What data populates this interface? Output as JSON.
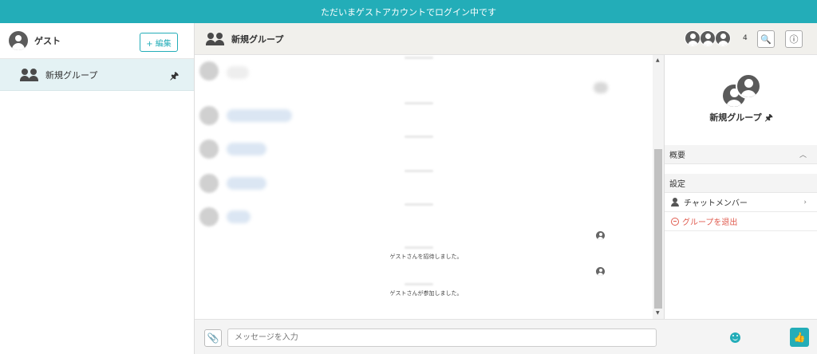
{
  "banner": {
    "text": "ただいまゲストアカウントでログイン中です"
  },
  "sidebar": {
    "user_name": "ゲスト",
    "edit_label": "+ 編集",
    "groups": [
      {
        "label": "新規グループ",
        "pinned": true,
        "pin_glyph": "🖈"
      }
    ]
  },
  "chat": {
    "title": "新規グループ",
    "member_count": "4",
    "system_messages": [
      "ゲストさんを招待しました。",
      "ゲストさんが参加しました。"
    ],
    "input": {
      "placeholder": "メッセージを入力"
    },
    "clip_glyph": "📎",
    "like_glyph": "👍",
    "search_glyph": "🔍",
    "info_glyph": "ⓘ"
  },
  "info_panel": {
    "title": "新規グループ",
    "pin_glyph": "🖈",
    "overview_label": "概要",
    "settings_label": "設定",
    "members_label": "チャットメンバー",
    "leave_label": "グループを退出",
    "chevron_up": "︿",
    "chevron_right": "›"
  },
  "colors": {
    "accent": "#23adb8",
    "danger": "#e05c50"
  },
  "icons": [
    "user-avatar-icon",
    "group-icon",
    "pin-icon",
    "search-icon",
    "info-icon",
    "clip-icon",
    "emoji-icon",
    "like-icon"
  ]
}
